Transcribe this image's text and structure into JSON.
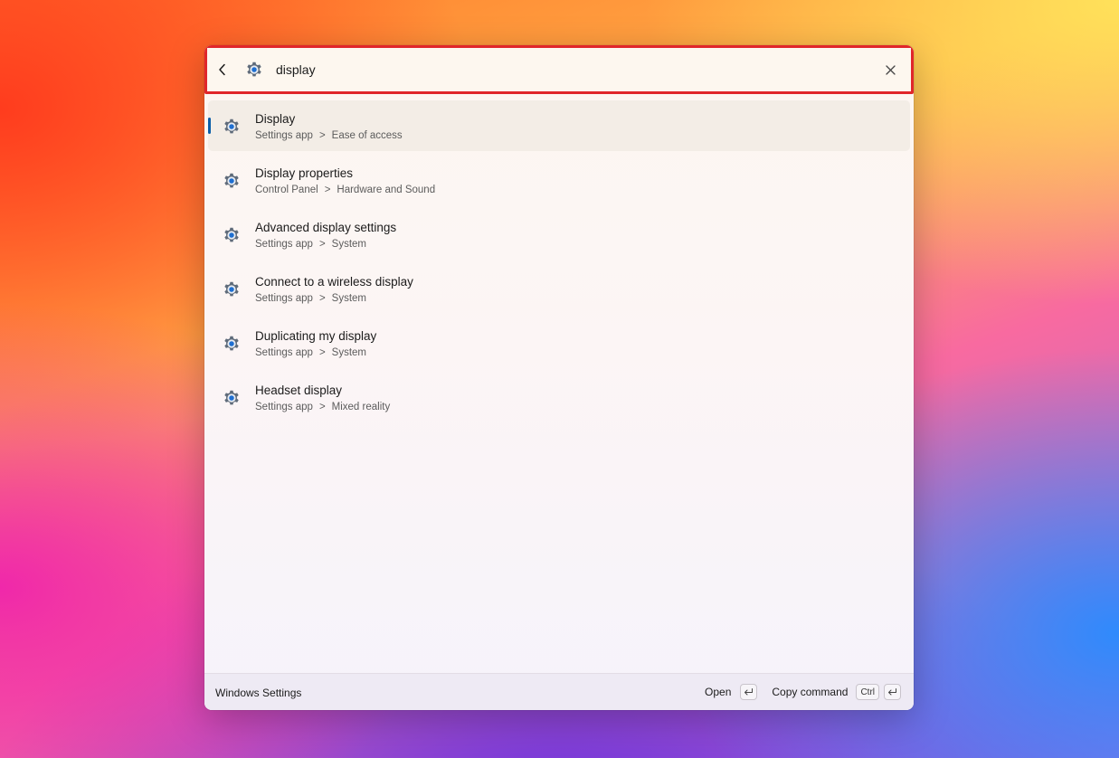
{
  "search": {
    "value": "display",
    "back_icon": "chevron-left-icon",
    "app_icon": "gear-icon",
    "clear_icon": "close-icon"
  },
  "results": [
    {
      "title": "Display",
      "path": [
        "Settings app",
        "Ease of access"
      ],
      "selected": true,
      "icon": "gear-icon"
    },
    {
      "title": "Display properties",
      "path": [
        "Control Panel",
        "Hardware and Sound"
      ],
      "icon": "gear-icon"
    },
    {
      "title": "Advanced display settings",
      "path": [
        "Settings app",
        "System"
      ],
      "icon": "gear-icon"
    },
    {
      "title": "Connect to a wireless display",
      "path": [
        "Settings app",
        "System"
      ],
      "icon": "gear-icon"
    },
    {
      "title": "Duplicating my display",
      "path": [
        "Settings app",
        "System"
      ],
      "icon": "gear-icon"
    },
    {
      "title": "Headset display",
      "path": [
        "Settings app",
        "Mixed reality"
      ],
      "icon": "gear-icon"
    }
  ],
  "path_separator": ">",
  "footer": {
    "title": "Windows Settings",
    "open_label": "Open",
    "copy_label": "Copy command",
    "ctrl_key": "Ctrl",
    "enter_icon": "enter-key-icon"
  },
  "colors": {
    "highlight_border": "#e0262b",
    "selection_accent": "#0a5ea8",
    "gear_body": "#5f6b7a",
    "gear_center": "#1f6fd1"
  }
}
